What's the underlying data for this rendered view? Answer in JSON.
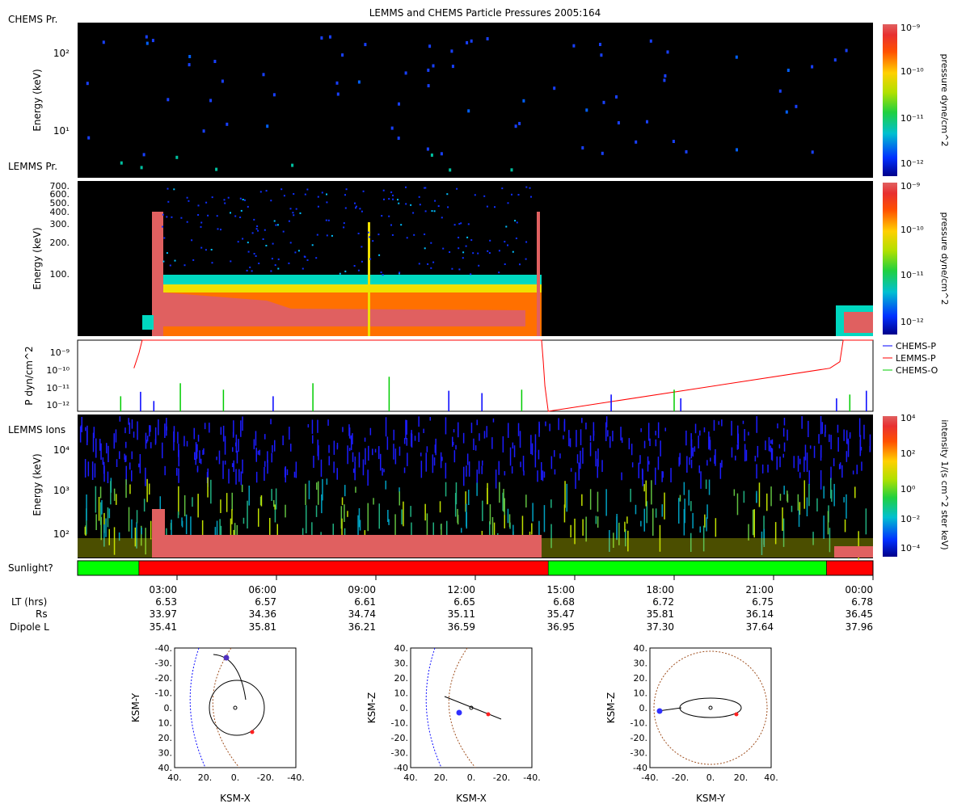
{
  "title": "LEMMS and CHEMS Particle Pressures  2005:164",
  "panels": {
    "chems_pressure": {
      "label": "CHEMS Pr.",
      "ylabel": "Energy (keV)",
      "yticks": [
        "10^2",
        "10^1"
      ],
      "colorbar": {
        "label": "pressure dyne/cm^2",
        "ticks": [
          "10^-9",
          "10^-10",
          "10^-11",
          "10^-12"
        ]
      }
    },
    "lemms_pressure": {
      "label": "LEMMS Pr.",
      "ylabel": "Energy (keV)",
      "yticks": [
        "700.",
        "600.",
        "500.",
        "400.",
        "300.",
        "200.",
        "100."
      ],
      "colorbar": {
        "label": "pressure dyne/cm^2",
        "ticks": [
          "10^-9",
          "10^-10",
          "10^-11",
          "10^-12"
        ]
      }
    },
    "pressure_lines": {
      "ylabel": "P dyn/cm^2",
      "yticks": [
        "10^-9",
        "10^-10",
        "10^-11",
        "10^-12"
      ],
      "legend": [
        {
          "name": "CHEMS-P",
          "color": "#0000ff"
        },
        {
          "name": "LEMMS-P",
          "color": "#ff0000"
        },
        {
          "name": "CHEMS-O",
          "color": "#00cc00"
        }
      ]
    },
    "lemms_ions": {
      "label": "LEMMS Ions",
      "ylabel": "Energy (keV)",
      "yticks": [
        "10^4",
        "10^3",
        "10^2"
      ],
      "colorbar": {
        "label": "intensity 1/(s cm^2 ster keV)",
        "ticks": [
          "10^4",
          "10^2",
          "10^0",
          "10^-2",
          "10^-4"
        ]
      }
    },
    "sunlight": {
      "label": "Sunlight?",
      "segments": [
        {
          "from": 0.0,
          "to": 1.85,
          "color": "#00ff00"
        },
        {
          "from": 1.85,
          "to": 14.2,
          "color": "#ff0000"
        },
        {
          "from": 14.2,
          "to": 22.6,
          "color": "#00ff00"
        },
        {
          "from": 22.6,
          "to": 24.0,
          "color": "#ff0000"
        }
      ]
    }
  },
  "time_axis": {
    "row_labels": [
      "LT (hrs)",
      "Rs",
      "Dipole L"
    ],
    "ticks": [
      {
        "t": 3,
        "time": "03:00",
        "lt": "6.53",
        "rs": "33.97",
        "l": "35.41"
      },
      {
        "t": 6,
        "time": "06:00",
        "lt": "6.57",
        "rs": "34.36",
        "l": "35.81"
      },
      {
        "t": 9,
        "time": "09:00",
        "lt": "6.61",
        "rs": "34.74",
        "l": "36.21"
      },
      {
        "t": 12,
        "time": "12:00",
        "lt": "6.65",
        "rs": "35.11",
        "l": "36.59"
      },
      {
        "t": 15,
        "time": "15:00",
        "lt": "6.68",
        "rs": "35.47",
        "l": "36.95"
      },
      {
        "t": 18,
        "time": "18:00",
        "lt": "6.72",
        "rs": "35.81",
        "l": "37.30"
      },
      {
        "t": 21,
        "time": "21:00",
        "lt": "6.75",
        "rs": "36.14",
        "l": "37.64"
      },
      {
        "t": 24,
        "time": "00:00",
        "lt": "6.78",
        "rs": "36.45",
        "l": "37.96"
      }
    ]
  },
  "orbit_plots": [
    {
      "xlabel": "KSM-X",
      "ylabel": "KSM-Y",
      "xticks": [
        "40.",
        "20.",
        "0.",
        "-20.",
        "-40."
      ],
      "yticks": [
        "-40.",
        "-30.",
        "-20.",
        "-10.",
        "0.",
        "10.",
        "20.",
        "30.",
        "40."
      ]
    },
    {
      "xlabel": "KSM-X",
      "ylabel": "KSM-Z",
      "xticks": [
        "40.",
        "20.",
        "0.",
        "-20.",
        "-40."
      ],
      "yticks": [
        "40.",
        "30.",
        "20.",
        "10.",
        "0.",
        "-10.",
        "-20.",
        "-30.",
        "-40"
      ]
    },
    {
      "xlabel": "KSM-Y",
      "ylabel": "KSM-Z",
      "xticks": [
        "-40.",
        "-20.",
        "0.",
        "20.",
        "40."
      ],
      "yticks": [
        "40.",
        "30.",
        "20.",
        "10.",
        "0.",
        "-10.",
        "-20.",
        "-30.",
        "-40"
      ]
    }
  ],
  "chart_data": [
    {
      "type": "line",
      "title": "LEMMS and CHEMS Particle Pressures  2005:164",
      "xlabel": "",
      "ylabel": "P dyn/cm^2",
      "x_range_hours": [
        0,
        24
      ],
      "ylim": [
        1e-12,
        2e-09
      ],
      "yscale": "log",
      "series": [
        {
          "name": "LEMMS-P",
          "points": [
            [
              1.7,
              1e-10
            ],
            [
              1.85,
              5e-10
            ],
            [
              1.95,
              2e-09
            ],
            [
              14.0,
              2e-09
            ],
            [
              14.05,
              2e-10
            ],
            [
              14.1,
              1.5e-11
            ],
            [
              14.2,
              1e-12
            ],
            [
              22.7,
              1e-10
            ],
            [
              23.0,
              2e-10
            ],
            [
              23.1,
              2e-09
            ],
            [
              24.0,
              2e-09
            ]
          ]
        },
        {
          "name": "CHEMS-P",
          "points": [
            [
              1.5,
              1e-12
            ],
            [
              1.9,
              8e-12
            ],
            [
              2.3,
              3e-12
            ],
            [
              5.9,
              5e-12
            ],
            [
              11.2,
              9e-12
            ],
            [
              12.2,
              7e-12
            ],
            [
              16.1,
              6e-12
            ],
            [
              18.2,
              4e-12
            ],
            [
              22.9,
              4e-12
            ],
            [
              23.8,
              9e-12
            ]
          ]
        },
        {
          "name": "CHEMS-O",
          "points": [
            [
              1.3,
              5e-12
            ],
            [
              3.1,
              2e-11
            ],
            [
              4.4,
              1e-11
            ],
            [
              7.1,
              2e-11
            ],
            [
              9.4,
              4e-11
            ],
            [
              13.4,
              1e-11
            ],
            [
              18.0,
              1e-11
            ],
            [
              23.3,
              6e-12
            ]
          ]
        }
      ]
    },
    {
      "type": "heatmap",
      "title": "LEMMS Pr.",
      "xlabel": "",
      "ylabel": "Energy (keV)",
      "x_range_hours": [
        0,
        24
      ],
      "yticks": [
        100,
        200,
        300,
        400,
        500,
        600,
        700
      ],
      "color_scale": "pressure dyne/cm^2, 1e-12 to 1e-9",
      "regions": [
        {
          "from": 1.7,
          "to": 14.2,
          "state": "high pressure (saturated) below ~80 keV"
        },
        {
          "from": 22.9,
          "to": 24.0,
          "state": "moderate pressure below ~50 keV"
        }
      ]
    },
    {
      "type": "heatmap",
      "title": "LEMMS Ions",
      "xlabel": "",
      "ylabel": "Energy (keV)",
      "x_range_hours": [
        0,
        24
      ],
      "ylim": [
        30,
        50000
      ],
      "color_scale": "intensity 1/(s cm^2 ster keV), 1e-4 to 1e4"
    }
  ]
}
